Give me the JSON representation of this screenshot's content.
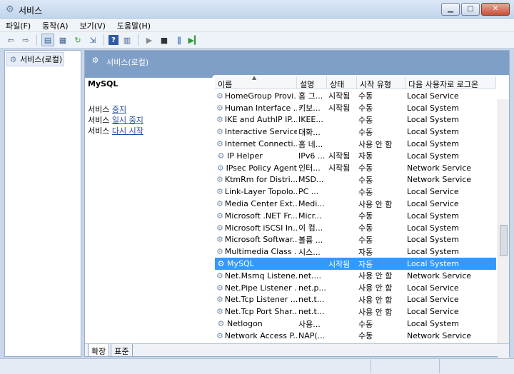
{
  "window": {
    "title": "서비스",
    "minimize": "▁",
    "maximize": "□",
    "close": "✕"
  },
  "menu": [
    "파일(F)",
    "동작(A)",
    "보기(V)",
    "도움말(H)"
  ],
  "tree": {
    "root_label": "서비스(로컬)"
  },
  "content": {
    "header_title": "서비스(로컬)",
    "service_name": "MySQL",
    "actions": [
      {
        "prefix": "서비스 ",
        "link": "중지"
      },
      {
        "prefix": "서비스 ",
        "link": "일시 중지"
      },
      {
        "prefix": "서비스 ",
        "link": "다시 시작"
      }
    ],
    "columns": [
      "이름",
      "설명",
      "상태",
      "시작 유형",
      "다음 사용자로 로그온"
    ],
    "rows": [
      {
        "name": "HomeGroup Provi...",
        "desc": "홈 그...",
        "status": "시작됨",
        "startup": "수동",
        "logon": "Local Service"
      },
      {
        "name": "Human Interface ...",
        "desc": "키보...",
        "status": "시작됨",
        "startup": "수동",
        "logon": "Local System"
      },
      {
        "name": "IKE and AuthIP IP...",
        "desc": "IKEE...",
        "status": "",
        "startup": "수동",
        "logon": "Local System"
      },
      {
        "name": "Interactive Service...",
        "desc": "대화...",
        "status": "",
        "startup": "수동",
        "logon": "Local System"
      },
      {
        "name": "Internet Connecti...",
        "desc": "홈 네...",
        "status": "",
        "startup": "사용 안 함",
        "logon": "Local System"
      },
      {
        "name": "IP Helper",
        "desc": "IPv6 ...",
        "status": "시작됨",
        "startup": "자동",
        "logon": "Local System"
      },
      {
        "name": "IPsec Policy Agent",
        "desc": "인터...",
        "status": "시작됨",
        "startup": "수동",
        "logon": "Network Service"
      },
      {
        "name": "KtmRm for Distri...",
        "desc": "MSD...",
        "status": "",
        "startup": "수동",
        "logon": "Network Service"
      },
      {
        "name": "Link-Layer Topolo...",
        "desc": "PC ...",
        "status": "",
        "startup": "수동",
        "logon": "Local Service"
      },
      {
        "name": "Media Center Ext...",
        "desc": "Medi...",
        "status": "",
        "startup": "사용 안 함",
        "logon": "Local Service"
      },
      {
        "name": "Microsoft .NET Fr...",
        "desc": "Micr...",
        "status": "",
        "startup": "수동",
        "logon": "Local System"
      },
      {
        "name": "Microsoft iSCSI In...",
        "desc": "이 컴...",
        "status": "",
        "startup": "수동",
        "logon": "Local System"
      },
      {
        "name": "Microsoft Softwar...",
        "desc": "볼륨 ...",
        "status": "",
        "startup": "수동",
        "logon": "Local System"
      },
      {
        "name": "Multimedia Class ...",
        "desc": "시스...",
        "status": "",
        "startup": "자동",
        "logon": "Local System"
      },
      {
        "name": "MySQL",
        "desc": "",
        "status": "시작됨",
        "startup": "자동",
        "logon": "Local System"
      },
      {
        "name": "Net.Msmq Listene...",
        "desc": "net....",
        "status": "",
        "startup": "사용 안 함",
        "logon": "Network Service"
      },
      {
        "name": "Net.Pipe Listener ...",
        "desc": "net.p...",
        "status": "",
        "startup": "사용 안 함",
        "logon": "Local Service"
      },
      {
        "name": "Net.Tcp Listener ...",
        "desc": "net.t...",
        "status": "",
        "startup": "사용 안 함",
        "logon": "Local Service"
      },
      {
        "name": "Net.Tcp Port Shar...",
        "desc": "net.t...",
        "status": "",
        "startup": "사용 안 함",
        "logon": "Local Service"
      },
      {
        "name": "Netlogon",
        "desc": "사용...",
        "status": "",
        "startup": "수동",
        "logon": "Local System"
      },
      {
        "name": "Network Access P...",
        "desc": "NAP(...",
        "status": "",
        "startup": "수동",
        "logon": "Network Service"
      }
    ],
    "selected_row": 14
  },
  "tabs": [
    "확장",
    "표준"
  ],
  "icons": {
    "app": "gear-icon",
    "service": "gear-icon",
    "toolbar": [
      "back-arrow-icon",
      "forward-arrow-icon",
      "console-tree-icon",
      "properties-icon",
      "refresh-icon",
      "export-icon",
      "help-icon",
      "action-pane-icon",
      "play-icon",
      "stop-icon",
      "pause-icon",
      "restart-icon"
    ]
  },
  "colors": {
    "selection": "#3399ff",
    "header": "#7f9fc6"
  }
}
